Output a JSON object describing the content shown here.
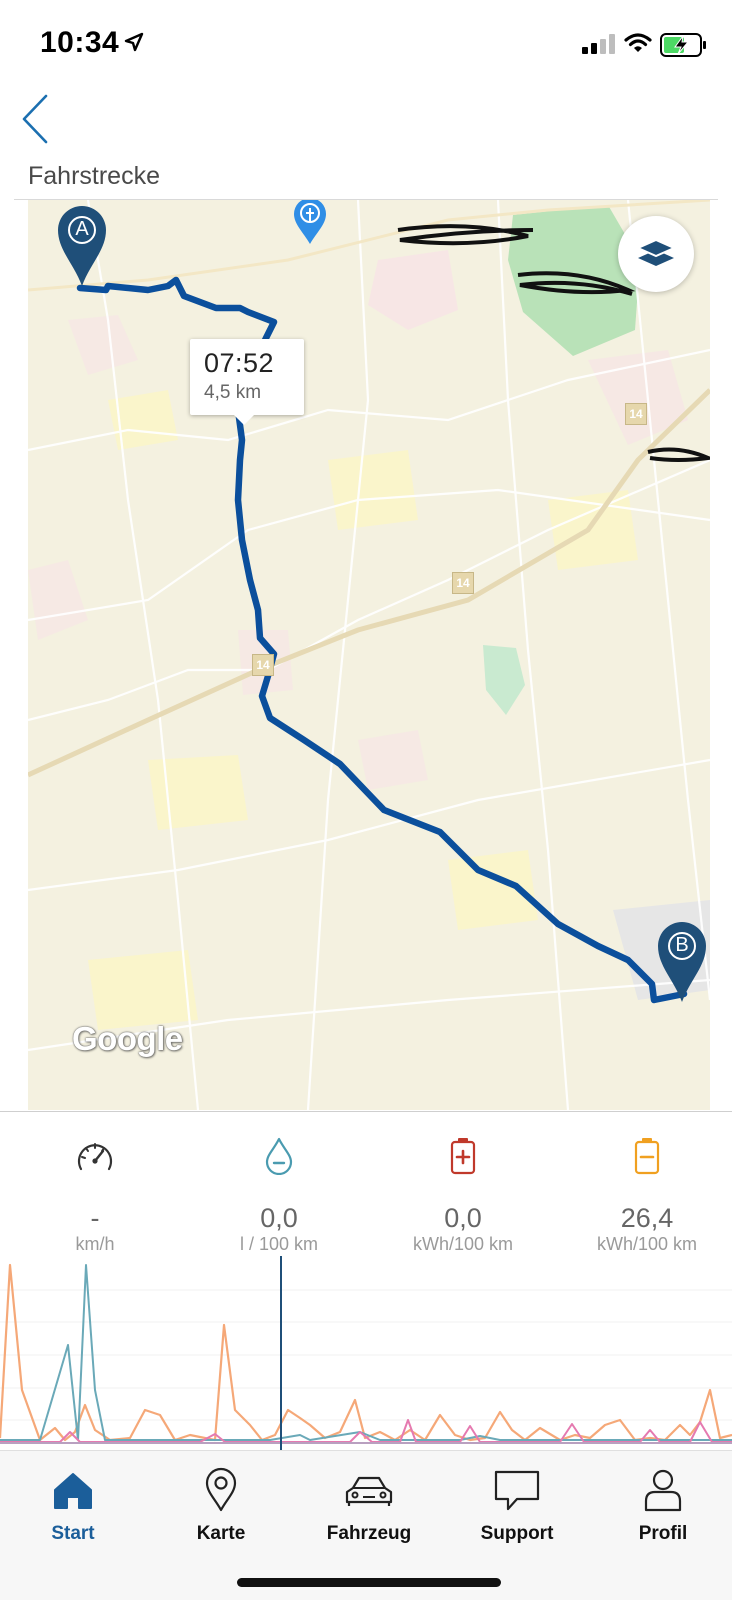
{
  "status_bar": {
    "time": "10:34"
  },
  "header": {
    "title": "Fahrstrecke"
  },
  "map": {
    "tooltip": {
      "time": "07:52",
      "distance": "4,5 km"
    },
    "start_marker": "A",
    "end_marker": "B",
    "road_labels": [
      "14",
      "14",
      "14"
    ],
    "attribution": "Google"
  },
  "metrics": [
    {
      "icon": "speedometer-icon",
      "value": "-",
      "unit": "km/h",
      "color": "#333333"
    },
    {
      "icon": "fuel-drop-icon",
      "value": "0,0",
      "unit": "l / 100 km",
      "color": "#4a9bb0"
    },
    {
      "icon": "battery-plus-icon",
      "value": "0,0",
      "unit": "kWh/100 km",
      "color": "#c0392b"
    },
    {
      "icon": "battery-minus-icon",
      "value": "26,4",
      "unit": "kWh/100 km",
      "color": "#f0a020"
    }
  ],
  "colors": {
    "route": "#0b4f9c",
    "marker": "#1f4f79",
    "accent": "#1b5e9a",
    "series_teal": "#6aa9b8",
    "series_orange": "#f5a878",
    "series_pink": "#e57ab0"
  },
  "tabbar": {
    "items": [
      {
        "label": "Start",
        "icon": "home-icon",
        "active": true
      },
      {
        "label": "Karte",
        "icon": "map-pin-icon",
        "active": false
      },
      {
        "label": "Fahrzeug",
        "icon": "car-icon",
        "active": false
      },
      {
        "label": "Support",
        "icon": "chat-bubble-icon",
        "active": false
      },
      {
        "label": "Profil",
        "icon": "person-icon",
        "active": false
      }
    ]
  }
}
